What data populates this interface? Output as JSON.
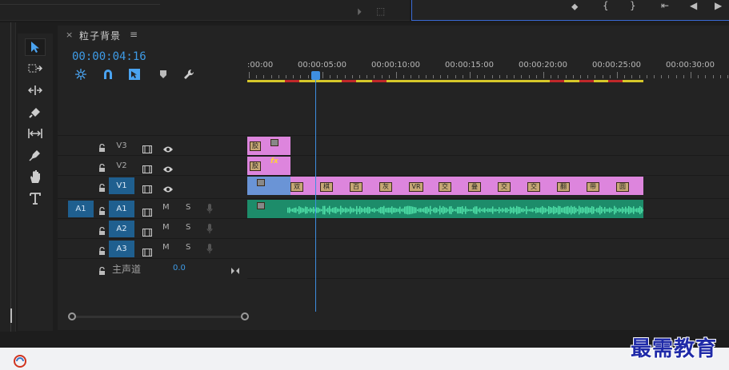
{
  "sequence": {
    "close_label": "×",
    "name": "粒子背景",
    "menu_label": "≡",
    "timecode": "00:00:04:16"
  },
  "ruler": {
    "labels": [
      ":00:00",
      "00:00:05:00",
      "00:00:10:00",
      "00:00:15:00",
      "00:00:20:00",
      "00:00:25:00",
      "00:00:30:00"
    ]
  },
  "tracks": {
    "v3": {
      "name": "V3"
    },
    "v2": {
      "name": "V2"
    },
    "v1": {
      "name": "V1"
    },
    "a1": {
      "source": "A1",
      "name": "A1",
      "mute": "M",
      "solo": "S"
    },
    "a2": {
      "name": "A2",
      "mute": "M",
      "solo": "S"
    },
    "a3": {
      "name": "A3",
      "mute": "M",
      "solo": "S"
    }
  },
  "master": {
    "label": "主声道",
    "value": "0.0"
  },
  "clips": {
    "v3_label": "胶",
    "v2_label": "胶",
    "v2_fx": "fx",
    "v1_labels": [
      "双",
      "棋",
      "百",
      "灰",
      "VR",
      "交",
      "叠",
      "交",
      "交",
      "翻",
      "带",
      "圆"
    ]
  },
  "watermark": "最需教育",
  "colors": {
    "accent_blue": "#3e9be6",
    "video_clip": "#dd85dd",
    "audio_clip": "#1d8c6a",
    "work_area": "#d6c72a",
    "render_red": "#c0282a"
  },
  "icons": {
    "tools": [
      "selection-tool-icon",
      "track-select-tool-icon",
      "ripple-edit-tool-icon",
      "razor-tool-icon",
      "slip-tool-icon",
      "pen-tool-icon",
      "hand-tool-icon",
      "type-tool-icon"
    ],
    "controls": [
      "nest-icon",
      "snap-icon",
      "linked-selection-icon",
      "add-marker-icon",
      "settings-wrench-icon"
    ]
  }
}
